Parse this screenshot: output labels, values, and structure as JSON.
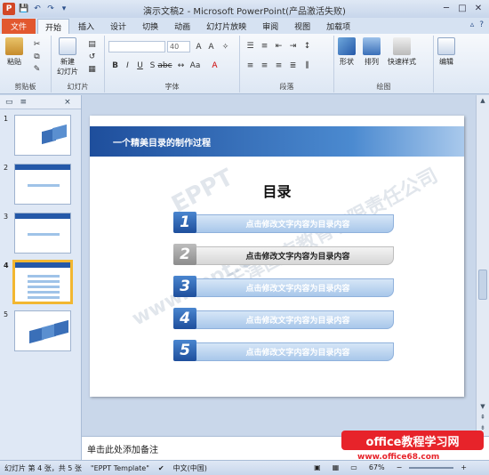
{
  "window": {
    "title": "演示文稿2 - Microsoft PowerPoint(产品激活失败)"
  },
  "app_icon": "P",
  "qat": {
    "save": "💾",
    "undo": "↶",
    "redo": "↷",
    "more": "▾"
  },
  "ribbon_tabs": [
    "文件",
    "开始",
    "插入",
    "设计",
    "切换",
    "动画",
    "幻灯片放映",
    "审阅",
    "视图",
    "加载项"
  ],
  "ribbon": {
    "clipboard": {
      "label": "剪贴板",
      "paste": "粘贴"
    },
    "slides": {
      "label": "幻灯片",
      "new_slide": "新建\n幻灯片"
    },
    "font": {
      "label": "字体",
      "size": "40"
    },
    "paragraph": {
      "label": "段落"
    },
    "drawing": {
      "label": "绘图",
      "shapes": "形状",
      "arrange": "排列",
      "quick_styles": "快速样式"
    },
    "editing": {
      "label": "编辑",
      "edit": "编辑"
    }
  },
  "pane": {
    "tab_outline": "▭",
    "tab_slides": "≡",
    "close": "×"
  },
  "thumbnails": [
    "1",
    "2",
    "3",
    "4",
    "5"
  ],
  "slide": {
    "header": "一个精美目录的制作过程",
    "toc_title": "目录",
    "items": [
      {
        "num": "1",
        "text": "点击修改文字内容为目录内容"
      },
      {
        "num": "2",
        "text": "点击修改文字内容为目录内容"
      },
      {
        "num": "3",
        "text": "点击修改文字内容为目录内容"
      },
      {
        "num": "4",
        "text": "点击修改文字内容为目录内容"
      },
      {
        "num": "5",
        "text": "点击修改文字内容为目录内容"
      }
    ],
    "watermarks": [
      "EPPT",
      "天津图南教育有限责任公司",
      "www.eppt.cn"
    ]
  },
  "notes": {
    "placeholder": "单击此处添加备注"
  },
  "promo": {
    "text": "office教程学习网",
    "url": "www.office68.com"
  },
  "status": {
    "slide_info": "幻灯片 第 4 张，共 5 张",
    "theme": "\"EPPT Template\"",
    "language": "中文(中国)",
    "zoom": "67%"
  }
}
